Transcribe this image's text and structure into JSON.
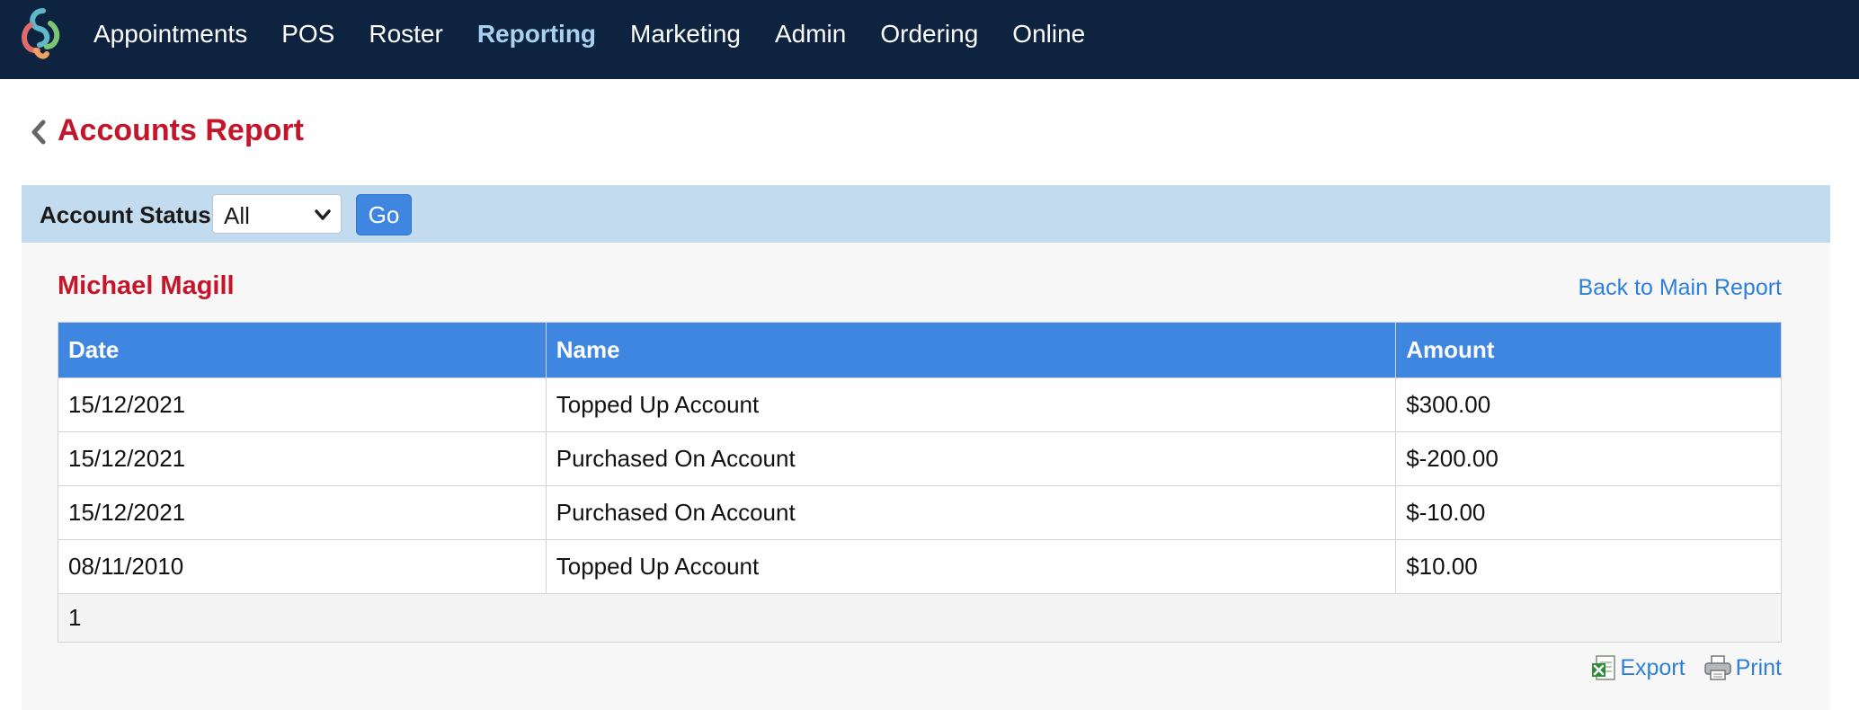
{
  "nav": {
    "items": [
      {
        "label": "Appointments",
        "active": false
      },
      {
        "label": "POS",
        "active": false
      },
      {
        "label": "Roster",
        "active": false
      },
      {
        "label": "Reporting",
        "active": true
      },
      {
        "label": "Marketing",
        "active": false
      },
      {
        "label": "Admin",
        "active": false
      },
      {
        "label": "Ordering",
        "active": false
      },
      {
        "label": "Online",
        "active": false
      }
    ]
  },
  "page": {
    "title": "Accounts Report",
    "back_icon": "chevron-left-icon"
  },
  "filter": {
    "label": "Account Status:",
    "selected": "All",
    "go_label": "Go"
  },
  "report": {
    "customer": "Michael Magill",
    "back_link": "Back to Main Report",
    "columns": [
      "Date",
      "Name",
      "Amount"
    ],
    "rows": [
      {
        "date": "15/12/2021",
        "name": "Topped Up Account",
        "amount": "$300.00"
      },
      {
        "date": "15/12/2021",
        "name": "Purchased On Account",
        "amount": "$-200.00"
      },
      {
        "date": "15/12/2021",
        "name": "Purchased On Account",
        "amount": "$-10.00"
      },
      {
        "date": "08/11/2010",
        "name": "Topped Up Account",
        "amount": "$10.00"
      }
    ],
    "pager": "1"
  },
  "actions": {
    "export_label": "Export",
    "print_label": "Print"
  },
  "colors": {
    "nav_bg": "#0e2340",
    "accent_red": "#c4162a",
    "accent_blue": "#3e86e0",
    "filter_bg": "#c3dbef",
    "link_blue": "#2f7fd8"
  }
}
